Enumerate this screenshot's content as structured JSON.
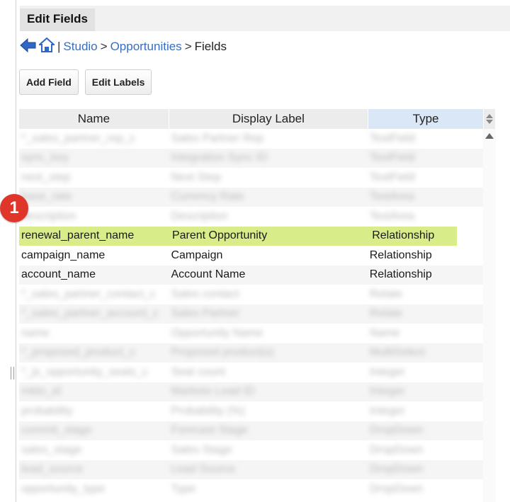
{
  "window": {
    "title": "Edit Fields"
  },
  "breadcrumb": {
    "separator": "|",
    "studio": "Studio",
    "gt1": ">",
    "module": "Opportunities",
    "gt2": ">",
    "current": "Fields"
  },
  "toolbar": {
    "add_field": "Add Field",
    "edit_labels": "Edit Labels"
  },
  "table": {
    "columns": [
      "Name",
      "Display Label",
      "Type"
    ],
    "rows": [
      {
        "name": "*_sales_partner_rep_c",
        "label": "Sales Partner Rep",
        "type": "TextField",
        "blurred": true
      },
      {
        "name": "sync_key",
        "label": "Integration Sync ID",
        "type": "TextField",
        "blurred": true
      },
      {
        "name": "next_step",
        "label": "Next Step",
        "type": "TextField",
        "blurred": true
      },
      {
        "name": "base_rate",
        "label": "Currency Rate",
        "type": "TextArea",
        "blurred": true
      },
      {
        "name": "description",
        "label": "Description",
        "type": "TextArea",
        "blurred": true
      },
      {
        "name": "renewal_parent_name",
        "label": "Parent Opportunity",
        "type": "Relationship",
        "blurred": false,
        "highlight": true
      },
      {
        "name": "campaign_name",
        "label": "Campaign",
        "type": "Relationship",
        "blurred": false
      },
      {
        "name": "account_name",
        "label": "Account Name",
        "type": "Relationship",
        "blurred": false
      },
      {
        "name": "*_sales_partner_contact_c",
        "label": "Sales contact",
        "type": "Relate",
        "blurred": true
      },
      {
        "name": "*_sales_partner_account_c",
        "label": "Sales Partner",
        "type": "Relate",
        "blurred": true
      },
      {
        "name": "name",
        "label": "Opportunity Name",
        "type": "Name",
        "blurred": true
      },
      {
        "name": "*_proposed_product_c",
        "label": "Proposed product(s)",
        "type": "MultiSelect",
        "blurred": true
      },
      {
        "name": "*_js_opportunity_seats_c",
        "label": "Seat count",
        "type": "Integer",
        "blurred": true
      },
      {
        "name": "mkto_id",
        "label": "Marketo Lead ID",
        "type": "Integer",
        "blurred": true
      },
      {
        "name": "probability",
        "label": "Probability (%)",
        "type": "Integer",
        "blurred": true
      },
      {
        "name": "commit_stage",
        "label": "Forecast Stage",
        "type": "DropDown",
        "blurred": true
      },
      {
        "name": "sales_stage",
        "label": "Sales Stage",
        "type": "DropDown",
        "blurred": true
      },
      {
        "name": "lead_source",
        "label": "Lead Source",
        "type": "DropDown",
        "blurred": true
      },
      {
        "name": "opportunity_type",
        "label": "Type",
        "type": "DropDown",
        "blurred": true
      }
    ]
  },
  "annotation": {
    "badge": "1"
  },
  "colors": {
    "link": "#3a6ebf",
    "highlight": "#d8ec8a",
    "badge": "#e0352b",
    "sorted_header": "#d9e7f7"
  },
  "icons": [
    "back-arrow-icon",
    "home-icon",
    "sort-icon",
    "scroll-up-icon"
  ]
}
